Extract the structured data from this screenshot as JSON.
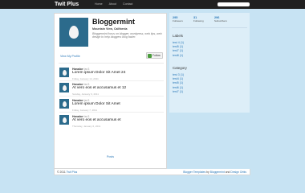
{
  "topbar": {
    "brand": "Twit Plus",
    "nav": [
      "Home",
      "About",
      "Contact"
    ]
  },
  "profile": {
    "name": "Bloggermint",
    "location": "Mountain View, California",
    "bio": "Bloggermint focus on blogger, wordpress, web tips, web design to help bloggers blog faster.",
    "view_profile": "View My Profile",
    "follow_label": "Follow"
  },
  "tweets": [
    {
      "user": "Hanalor",
      "handle": "fan3",
      "text": "Lorem ipsum Dolor Sit Amet 24",
      "date": "Friday, January 14, 2011"
    },
    {
      "user": "Hanalor",
      "handle": "fan3",
      "text": "At vero eos et accusamus et 12",
      "date": "Sunday, January 9, 2011"
    },
    {
      "user": "Hanalor",
      "handle": "fan3",
      "text": "Lorem ipsum Dolor Sit Amet",
      "date": "Friday, January 7, 2011"
    },
    {
      "user": "Hanalor",
      "handle": "fan3",
      "text": "At vero eos et accusamus et",
      "date": "Thursday, January 6, 2011"
    }
  ],
  "reply_link": "Posts",
  "subscribe": {
    "prefix": "Subscribe to:",
    "link": "Posts (Atom)"
  },
  "sidebar": {
    "stats": [
      {
        "num": "295",
        "label": "Followers"
      },
      {
        "num": "31",
        "label": "Following"
      },
      {
        "num": "296",
        "label": "Subscribers"
      }
    ],
    "labels_heading": "Labels",
    "labels": [
      "test 4 (1)",
      "test5 (1)",
      "test7 (1)",
      "test8 (1)"
    ],
    "category_heading": "Category",
    "category": [
      "test 3 (1)",
      "test4 (1)",
      "test5 (1)",
      "test6 (1)",
      "test7 (1)"
    ]
  },
  "footer": {
    "copyright": "© 2011",
    "site": "Twit Plus",
    "right_prefix": "Blogger Templates",
    "right_by": "by",
    "right_author": "Bloggermint",
    "right_and": "and",
    "right_design": "Design Orbis"
  },
  "colors": {
    "page_bg": "#c7e3f3",
    "topbar": "#202020",
    "avatar": "#2c6b8c",
    "link": "#2a78b8",
    "sidebar_bg": "#ddeef8"
  }
}
